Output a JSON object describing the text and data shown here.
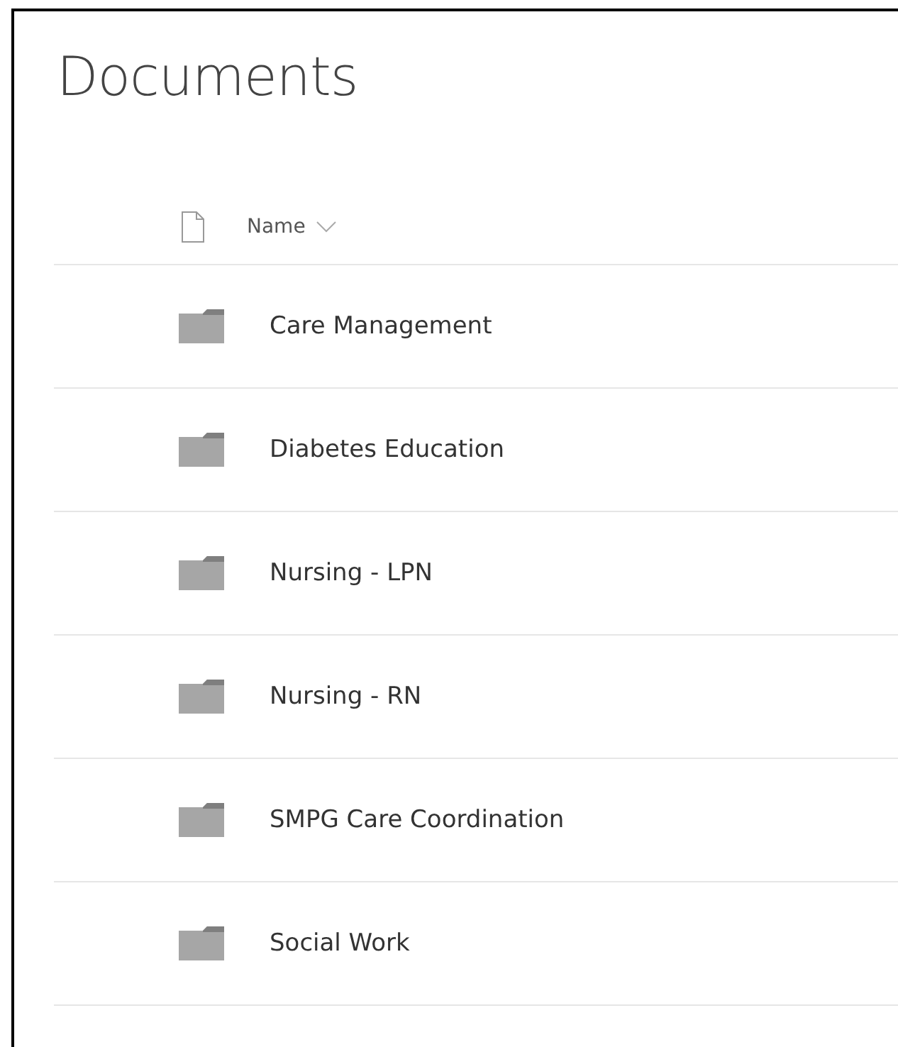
{
  "title": "Documents",
  "columns": [
    {
      "label": "Name",
      "sorted": true
    }
  ],
  "rows": [
    {
      "kind": "folder",
      "name": "Care Management"
    },
    {
      "kind": "folder",
      "name": "Diabetes Education"
    },
    {
      "kind": "folder",
      "name": "Nursing - LPN"
    },
    {
      "kind": "folder",
      "name": "Nursing - RN"
    },
    {
      "kind": "folder",
      "name": "SMPG Care Coordination"
    },
    {
      "kind": "folder",
      "name": "Social Work"
    }
  ]
}
